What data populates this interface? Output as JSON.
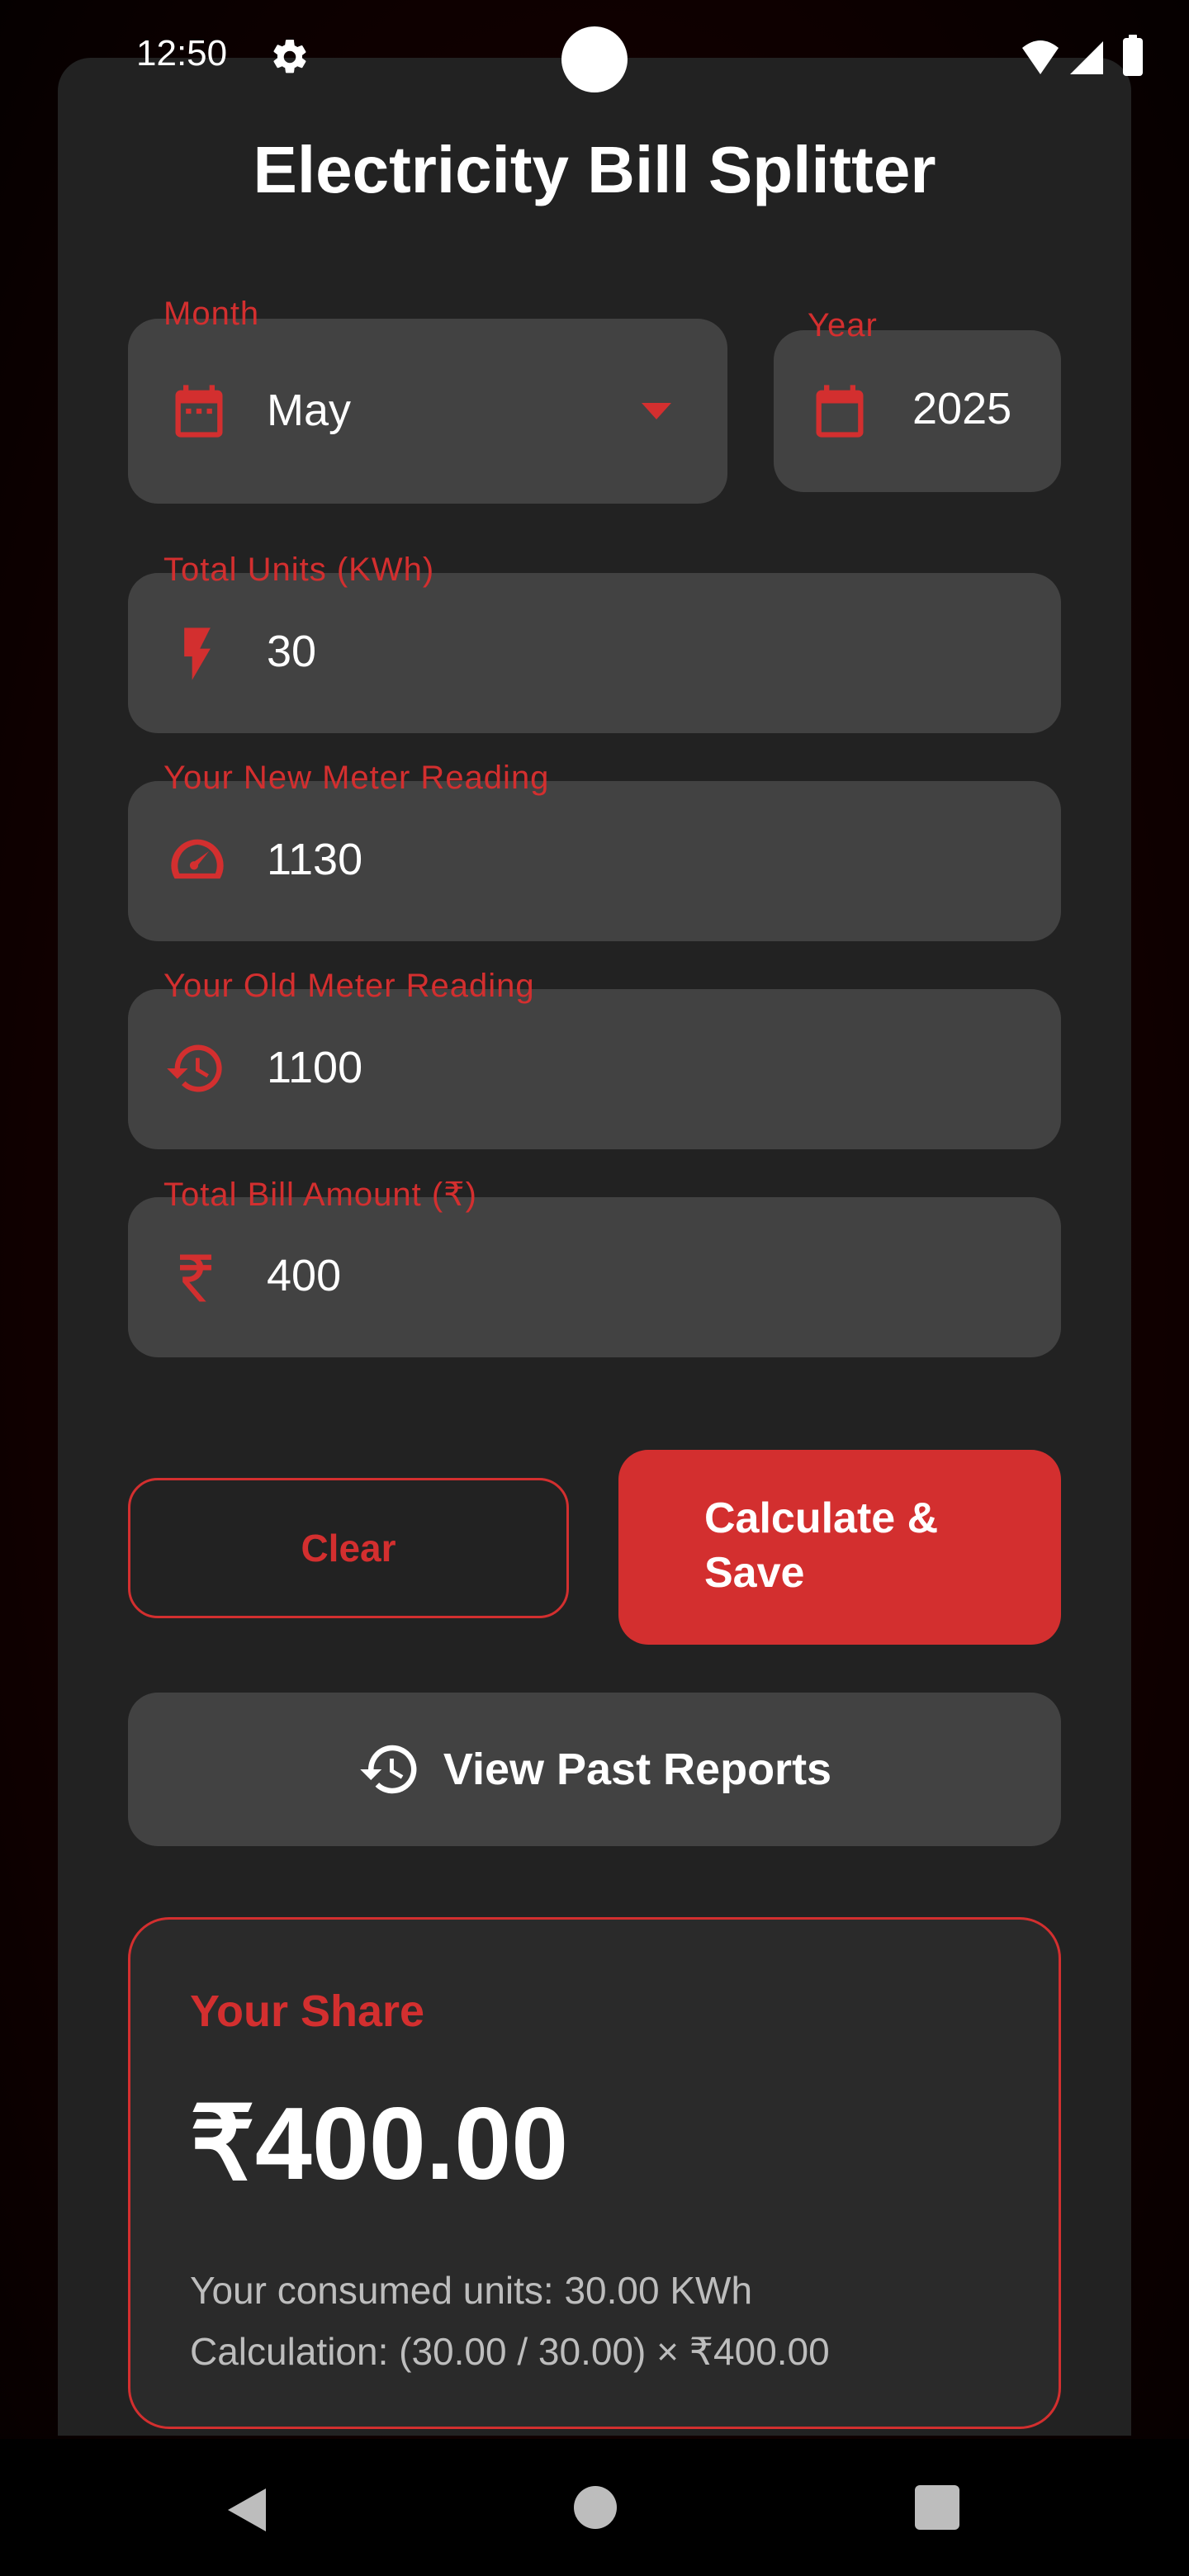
{
  "status_bar": {
    "time": "12:50"
  },
  "app": {
    "title": "Electricity Bill Splitter"
  },
  "form": {
    "month": {
      "label": "Month",
      "value": "May",
      "icon": "calendar-icon"
    },
    "year": {
      "label": "Year",
      "value": "2025",
      "icon": "calendar-icon"
    },
    "total_units": {
      "label": "Total Units (KWh)",
      "value": "30",
      "icon": "bolt-icon"
    },
    "new_reading": {
      "label": "Your New Meter Reading",
      "value": "1130",
      "icon": "speedometer-icon"
    },
    "old_reading": {
      "label": "Your Old Meter Reading",
      "value": "1100",
      "icon": "history-icon"
    },
    "bill_amount": {
      "label": "Total Bill Amount (₹)",
      "value": "400",
      "icon": "rupee-icon"
    }
  },
  "buttons": {
    "clear": "Clear",
    "calculate": "Calculate & Save",
    "view_past": "View Past Reports"
  },
  "result": {
    "title": "Your Share",
    "amount": "₹400.00",
    "consumed": "Your consumed units: 30.00 KWh",
    "calculation": "Calculation: (30.00 / 30.00) × ₹400.00"
  },
  "colors": {
    "accent": "#d32f2f",
    "surface": "#222222",
    "field": "#424242"
  }
}
